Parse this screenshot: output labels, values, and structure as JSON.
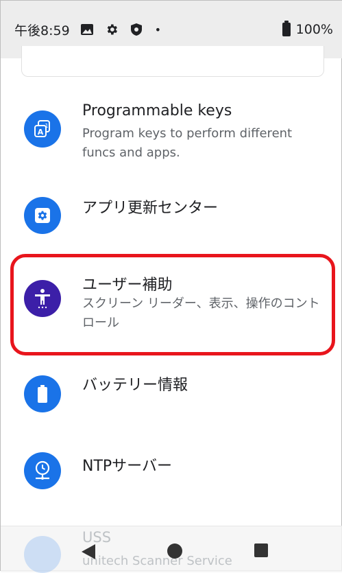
{
  "status_bar": {
    "time": "午後8:59",
    "icons": [
      "image-icon",
      "gear-icon",
      "shield-icon",
      "dot-icon"
    ],
    "battery": "100%"
  },
  "settings": {
    "items": [
      {
        "icon": "keyboard-icon",
        "title": "Programmable keys",
        "subtitle": "Program keys to perform different funcs and apps.",
        "color": "#1a73e8"
      },
      {
        "icon": "gear-icon",
        "title": "アプリ更新センター",
        "subtitle": "",
        "color": "#1a73e8"
      },
      {
        "icon": "accessibility-icon",
        "title": "ユーザー補助",
        "subtitle": "スクリーン リーダー、表示、操作のコントロール",
        "color": "#3c1fa8",
        "highlighted": true
      },
      {
        "icon": "battery-icon",
        "title": "バッテリー情報",
        "subtitle": "",
        "color": "#1a73e8"
      },
      {
        "icon": "clock-icon",
        "title": "NTPサーバー",
        "subtitle": "",
        "color": "#1a73e8"
      },
      {
        "icon": "qr-icon",
        "title": "USS",
        "subtitle": "unitech Scanner Service",
        "color": "#1a73e8"
      }
    ]
  },
  "highlight_color": "#e8151c",
  "nav_bar": {
    "buttons": [
      "back-button",
      "home-button",
      "recents-button"
    ]
  }
}
